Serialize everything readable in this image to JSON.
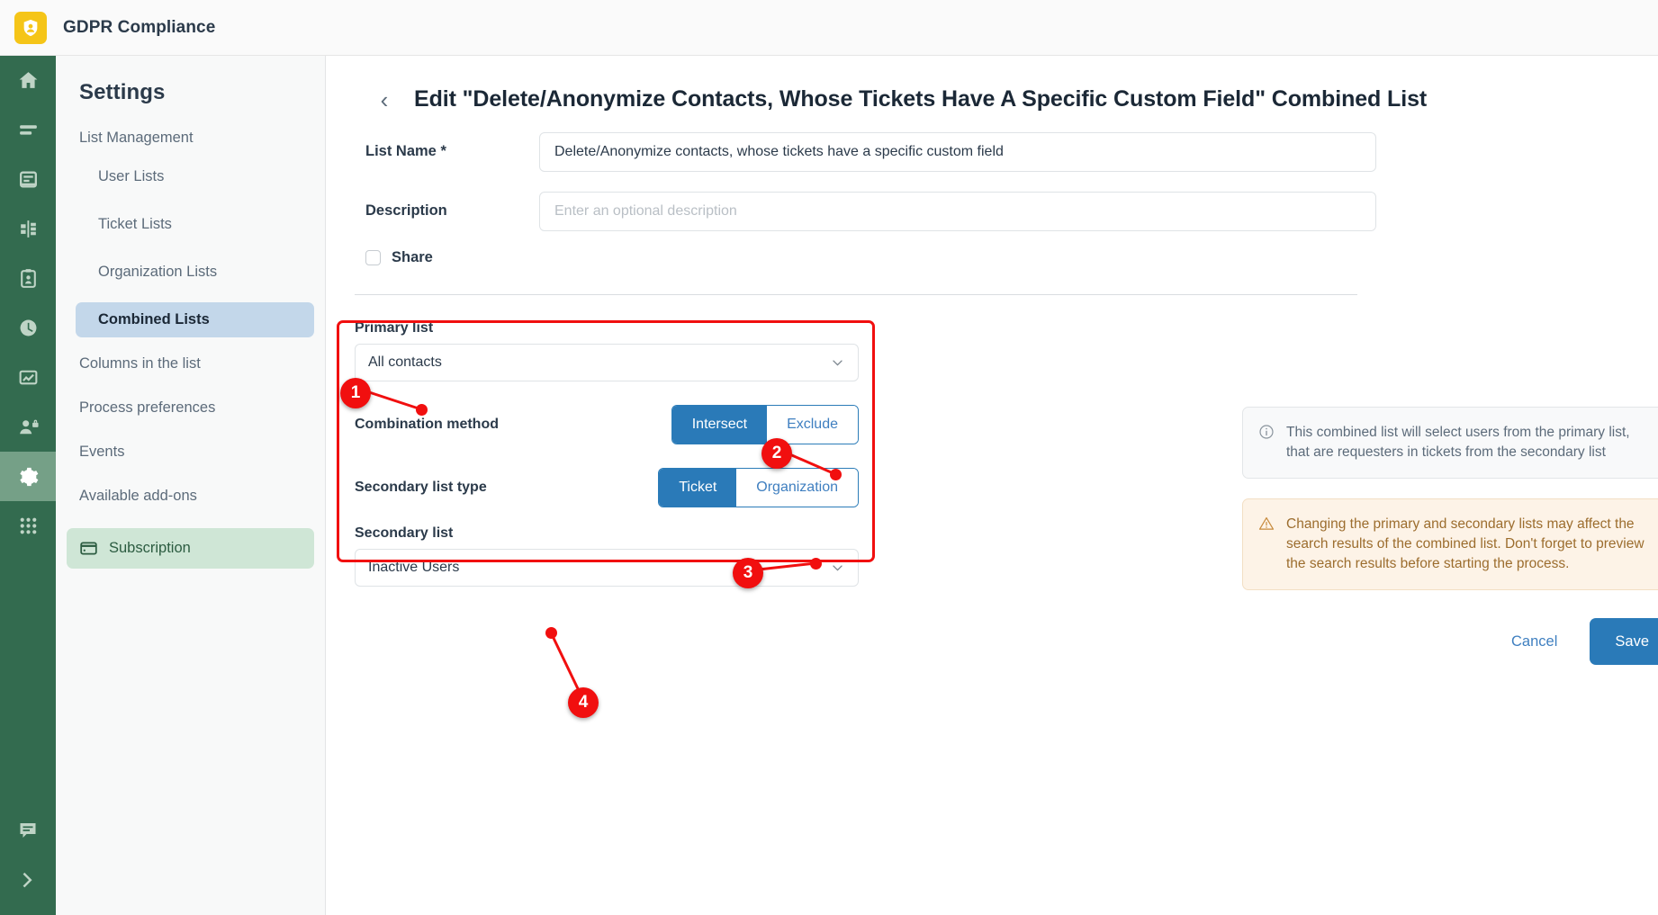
{
  "topbar": {
    "app_title": "GDPR Compliance",
    "logo_icon": "shield-user-icon"
  },
  "rail": {
    "items": [
      {
        "icon": "home-icon",
        "active": false
      },
      {
        "icon": "list-icon",
        "active": false
      },
      {
        "icon": "database-icon",
        "active": false
      },
      {
        "icon": "merge-icon",
        "active": false
      },
      {
        "icon": "clipboard-user-icon",
        "active": false
      },
      {
        "icon": "clock-icon",
        "active": false
      },
      {
        "icon": "chart-icon",
        "active": false
      },
      {
        "icon": "user-lock-icon",
        "active": false
      },
      {
        "icon": "gear-icon",
        "active": true
      },
      {
        "icon": "grid-apps-icon",
        "active": false
      }
    ],
    "bottom_items": [
      {
        "icon": "comment-icon"
      },
      {
        "icon": "chevron-right-icon"
      }
    ]
  },
  "sidebar": {
    "heading": "Settings",
    "group_label": "List Management",
    "sub_items": [
      {
        "label": "User Lists",
        "active": false
      },
      {
        "label": "Ticket Lists",
        "active": false
      },
      {
        "label": "Organization Lists",
        "active": false
      },
      {
        "label": "Combined Lists",
        "active": true
      }
    ],
    "top_items": [
      {
        "label": "Columns in the list"
      },
      {
        "label": "Process preferences"
      },
      {
        "label": "Events"
      },
      {
        "label": "Available add-ons"
      }
    ],
    "subscription": {
      "label": "Subscription",
      "icon": "credit-card-icon"
    }
  },
  "page": {
    "back_icon": "chevron-left-icon",
    "title": "Edit \"Delete/Anonymize Contacts, Whose Tickets Have A Specific Custom Field\" Combined List"
  },
  "form": {
    "list_name_label": "List Name *",
    "list_name_value": "Delete/Anonymize contacts, whose tickets have a specific custom field",
    "description_label": "Description",
    "description_placeholder": "Enter an optional description",
    "share_label": "Share",
    "share_checked": false
  },
  "panel": {
    "primary_list_label": "Primary list",
    "primary_list_value": "All contacts",
    "combination_method_label": "Combination method",
    "combination_options": [
      {
        "label": "Intersect",
        "selected": true
      },
      {
        "label": "Exclude",
        "selected": false
      }
    ],
    "secondary_type_label": "Secondary list type",
    "secondary_type_options": [
      {
        "label": "Ticket",
        "selected": true
      },
      {
        "label": "Organization",
        "selected": false
      }
    ],
    "secondary_list_label": "Secondary list",
    "secondary_list_value": "Inactive Users",
    "dropdown_icon": "chevron-down-icon"
  },
  "callouts": [
    {
      "number": "1"
    },
    {
      "number": "2"
    },
    {
      "number": "3"
    },
    {
      "number": "4"
    }
  ],
  "notes": {
    "info_icon": "info-circle-icon",
    "info_text": "This combined list will select users from the primary list, that are requesters in tickets from the secondary list",
    "warn_icon": "warning-triangle-icon",
    "warn_text": "Changing the primary and secondary lists may affect the search results of the combined list. Don't forget to preview the search results before starting the process."
  },
  "actions": {
    "cancel_label": "Cancel",
    "save_label": "Save"
  },
  "colors": {
    "rail_green": "#336b4f",
    "accent_blue": "#2a7ab8",
    "callout_red": "#f10f0f",
    "highlight_blue": "#c3d7ea",
    "subscription_green": "#cfe6d6",
    "logo_yellow": "#f5c518"
  }
}
